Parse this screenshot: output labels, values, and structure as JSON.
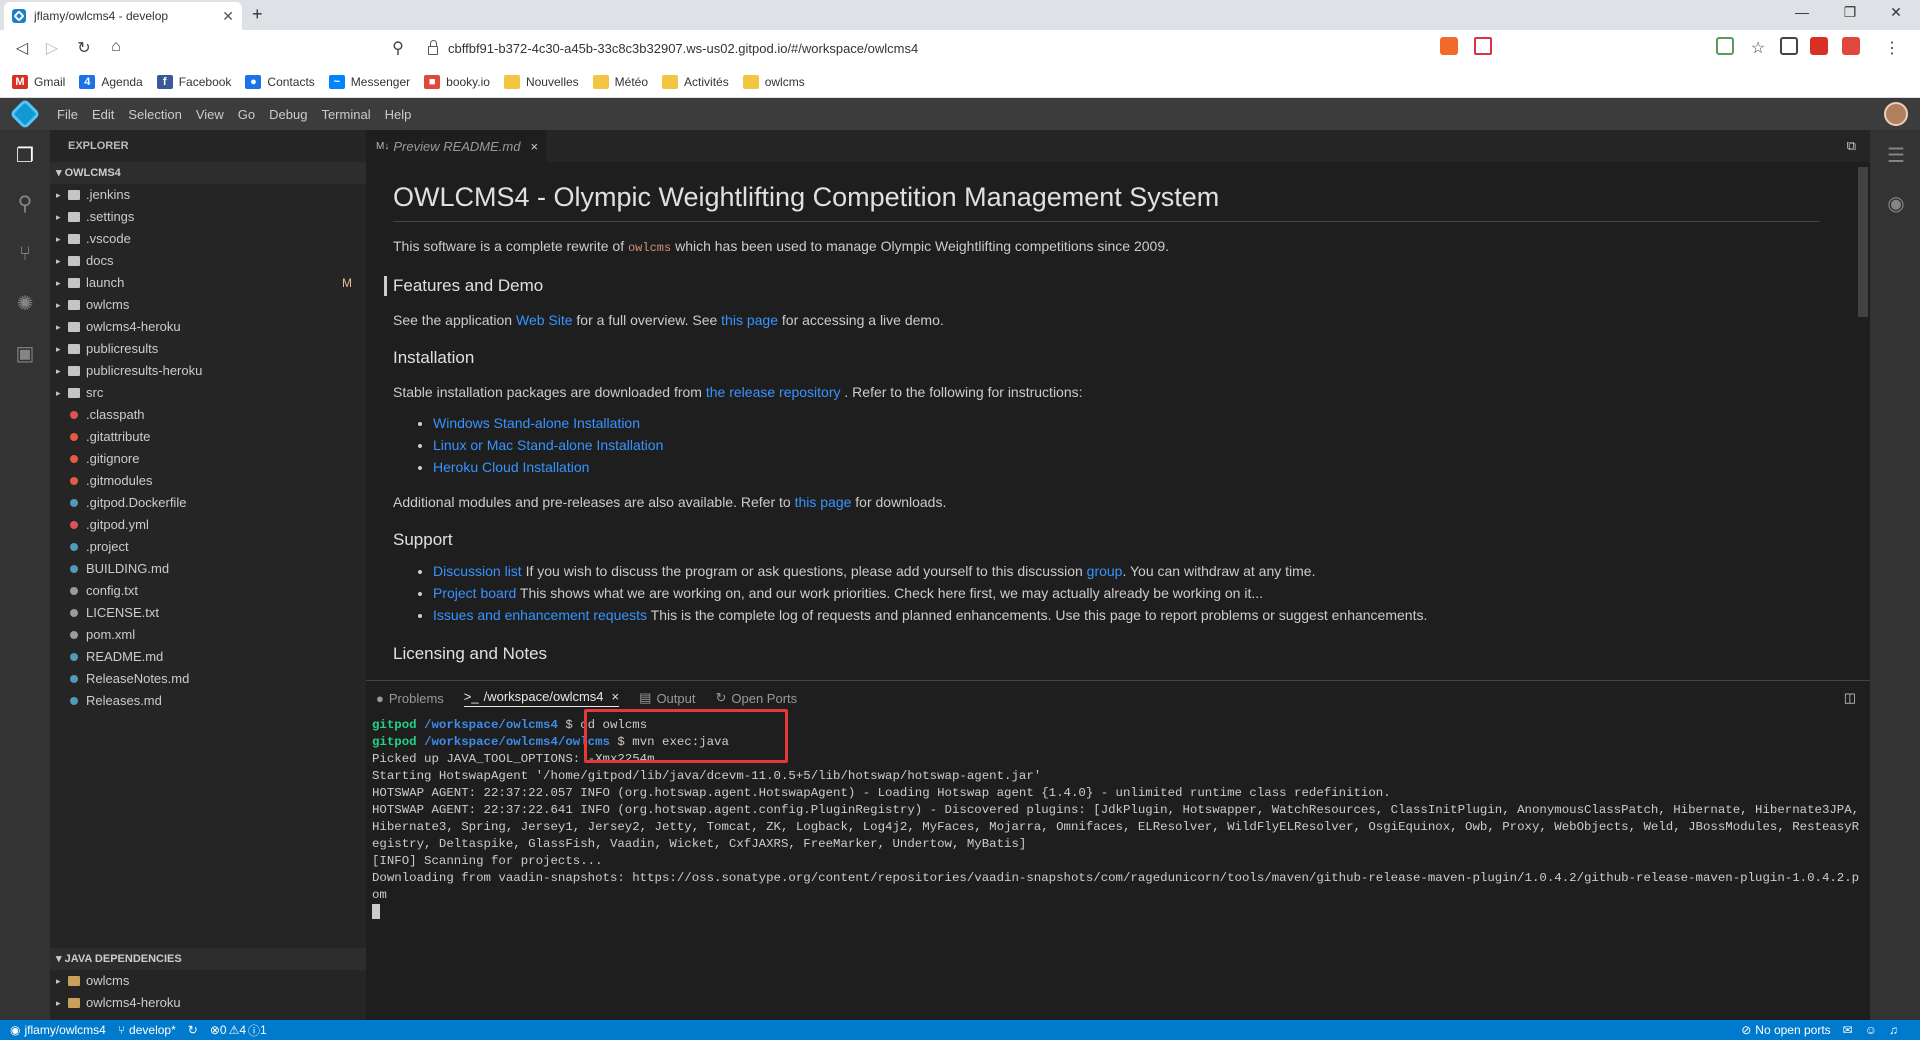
{
  "browser": {
    "tab_title": "jflamy/owlcms4 - develop",
    "tab_close": "✕",
    "new_tab": "+",
    "url": "cbffbf91-b372-4c30-a45b-33c8c3b32907.ws-us02.gitpod.io/#/workspace/owlcms4",
    "brave_count": "2",
    "alert_count": "1",
    "bookmarks": [
      {
        "label": "Gmail",
        "icon": "gmail-icon",
        "color": "#d93025",
        "glyph": "M"
      },
      {
        "label": "Agenda",
        "icon": "calendar-icon",
        "color": "#1a73e8",
        "glyph": "4"
      },
      {
        "label": "Facebook",
        "icon": "facebook-icon",
        "color": "#3b5998",
        "glyph": "f"
      },
      {
        "label": "Contacts",
        "icon": "contacts-icon",
        "color": "#1a73e8",
        "glyph": "●"
      },
      {
        "label": "Messenger",
        "icon": "messenger-icon",
        "color": "#0084ff",
        "glyph": "~"
      },
      {
        "label": "booky.io",
        "icon": "booky-icon",
        "color": "#e0483e",
        "glyph": "■"
      },
      {
        "label": "Nouvelles",
        "icon": "folder-icon",
        "color": "#f4c542",
        "glyph": ""
      },
      {
        "label": "Météo",
        "icon": "folder-icon",
        "color": "#f4c542",
        "glyph": ""
      },
      {
        "label": "Activités",
        "icon": "folder-icon",
        "color": "#f4c542",
        "glyph": ""
      },
      {
        "label": "owlcms",
        "icon": "folder-icon",
        "color": "#f4c542",
        "glyph": ""
      }
    ]
  },
  "ide": {
    "menu": [
      "File",
      "Edit",
      "Selection",
      "View",
      "Go",
      "Debug",
      "Terminal",
      "Help"
    ],
    "explorer_title": "EXPLORER",
    "workspace_section": "OWLCMS4",
    "tree": [
      {
        "name": ".jenkins",
        "type": "folder"
      },
      {
        "name": ".settings",
        "type": "folder"
      },
      {
        "name": ".vscode",
        "type": "folder"
      },
      {
        "name": "docs",
        "type": "folder"
      },
      {
        "name": "launch",
        "type": "folder",
        "mark": "M"
      },
      {
        "name": "owlcms",
        "type": "folder"
      },
      {
        "name": "owlcms4-heroku",
        "type": "folder"
      },
      {
        "name": "publicresults",
        "type": "folder"
      },
      {
        "name": "publicresults-heroku",
        "type": "folder"
      },
      {
        "name": "src",
        "type": "folder"
      },
      {
        "name": ".classpath",
        "type": "file",
        "color": "#e05252"
      },
      {
        "name": ".gitattribute",
        "type": "file",
        "color": "#e05d44"
      },
      {
        "name": ".gitignore",
        "type": "file",
        "color": "#e05d44"
      },
      {
        "name": ".gitmodules",
        "type": "file",
        "color": "#e05d44"
      },
      {
        "name": ".gitpod.Dockerfile",
        "type": "file",
        "color": "#519aba"
      },
      {
        "name": ".gitpod.yml",
        "type": "file",
        "color": "#e05252"
      },
      {
        "name": ".project",
        "type": "file",
        "color": "#519aba"
      },
      {
        "name": "BUILDING.md",
        "type": "file",
        "color": "#519aba"
      },
      {
        "name": "config.txt",
        "type": "file",
        "color": "#9b9b9b"
      },
      {
        "name": "LICENSE.txt",
        "type": "file",
        "color": "#9b9b9b"
      },
      {
        "name": "pom.xml",
        "type": "file",
        "color": "#9b9b9b"
      },
      {
        "name": "README.md",
        "type": "file",
        "color": "#519aba"
      },
      {
        "name": "ReleaseNotes.md",
        "type": "file",
        "color": "#519aba"
      },
      {
        "name": "Releases.md",
        "type": "file",
        "color": "#519aba"
      }
    ],
    "java_section": "JAVA DEPENDENCIES",
    "java_deps": [
      "owlcms",
      "owlcms4-heroku"
    ],
    "editor_tab": "Preview README.md",
    "editor_tab_close": "×"
  },
  "readme": {
    "h1": "OWLCMS4 - Olympic Weightlifting Competition Management System",
    "intro_before": "This software is a complete rewrite of ",
    "intro_code": "owlcms",
    "intro_after": " which has been used to manage Olympic Weightlifting competitions since 2009.",
    "features_title": "Features and Demo",
    "features_before": "See the application ",
    "features_link1": "Web Site",
    "features_mid": " for a full overview. See ",
    "features_link2": "this page",
    "features_after": " for accessing a live demo.",
    "install_title": "Installation",
    "install_before": "Stable installation packages are downloaded from ",
    "install_link": "the release repository",
    "install_after": " . Refer to the following for instructions:",
    "install_items": [
      "Windows Stand-alone Installation",
      "Linux or Mac Stand-alone Installation",
      "Heroku Cloud Installation"
    ],
    "modules_before": "Additional modules and pre-releases are also available. Refer to ",
    "modules_link": "this page",
    "modules_after": " for downloads.",
    "support_title": "Support",
    "support_items": [
      {
        "link": "Discussion list",
        "text": " If you wish to discuss the program or ask questions, please add yourself to this discussion ",
        "link2": "group",
        "text2": ". You can withdraw at any time."
      },
      {
        "link": "Project board",
        "text": " This shows what we are working on, and our work priorities. Check here first, we may actually already be working on it...",
        "link2": "",
        "text2": ""
      },
      {
        "link": "Issues and enhancement requests",
        "text": " This is the complete log of requests and planned enhancements. Use this page to report problems or suggest enhancements.",
        "link2": "",
        "text2": ""
      }
    ],
    "licensing_title": "Licensing and Notes"
  },
  "panel": {
    "tabs": [
      "Problems",
      "/workspace/owlcms4",
      "Output",
      "Open Ports"
    ],
    "terminal_close": "×",
    "lines": [
      {
        "prompt": "gitpod",
        "path": "/workspace/owlcms4",
        "cmd": " $ cd owlcms"
      },
      {
        "prompt": "gitpod",
        "path": "/workspace/owlcms4/owlcms",
        "cmd": " $ mvn exec:java"
      },
      {
        "text": "Picked up JAVA_TOOL_OPTIONS: -Xmx2254m"
      },
      {
        "text": "Starting HotswapAgent '/home/gitpod/lib/java/dcevm-11.0.5+5/lib/hotswap/hotswap-agent.jar'"
      },
      {
        "text": "HOTSWAP AGENT: 22:37:22.057 INFO (org.hotswap.agent.HotswapAgent) - Loading Hotswap agent {1.4.0} - unlimited runtime class redefinition."
      },
      {
        "text": "HOTSWAP AGENT: 22:37:22.641 INFO (org.hotswap.agent.config.PluginRegistry) - Discovered plugins: [JdkPlugin, Hotswapper, WatchResources, ClassInitPlugin, AnonymousClassPatch, Hibernate, Hibernate3JPA, Hibernate3, Spring, Jersey1, Jersey2, Jetty, Tomcat, ZK, Logback, Log4j2, MyFaces, Mojarra, Omnifaces, ELResolver, WildFlyELResolver, OsgiEquinox, Owb, Proxy, WebObjects, Weld, JBossModules, ResteasyRegistry, Deltaspike, GlassFish, Vaadin, Wicket, CxfJAXRS, FreeMarker, Undertow, MyBatis]"
      },
      {
        "text": "[INFO] Scanning for projects..."
      },
      {
        "text": "Downloading from vaadin-snapshots: https://oss.sonatype.org/content/repositories/vaadin-snapshots/com/ragedunicorn/tools/maven/github-release-maven-plugin/1.0.4.2/github-release-maven-plugin-1.0.4.2.pom"
      }
    ]
  },
  "status": {
    "repo": "jflamy/owlcms4",
    "branch": "develop*",
    "errors": "0",
    "warnings": "4",
    "infos": "1",
    "ports": "No open ports"
  },
  "colors": {
    "accent": "#007acc",
    "link": "#3794ff",
    "highlight_box": "#e53935",
    "prompt_green": "#23d18b",
    "path_blue": "#3b8eea"
  }
}
